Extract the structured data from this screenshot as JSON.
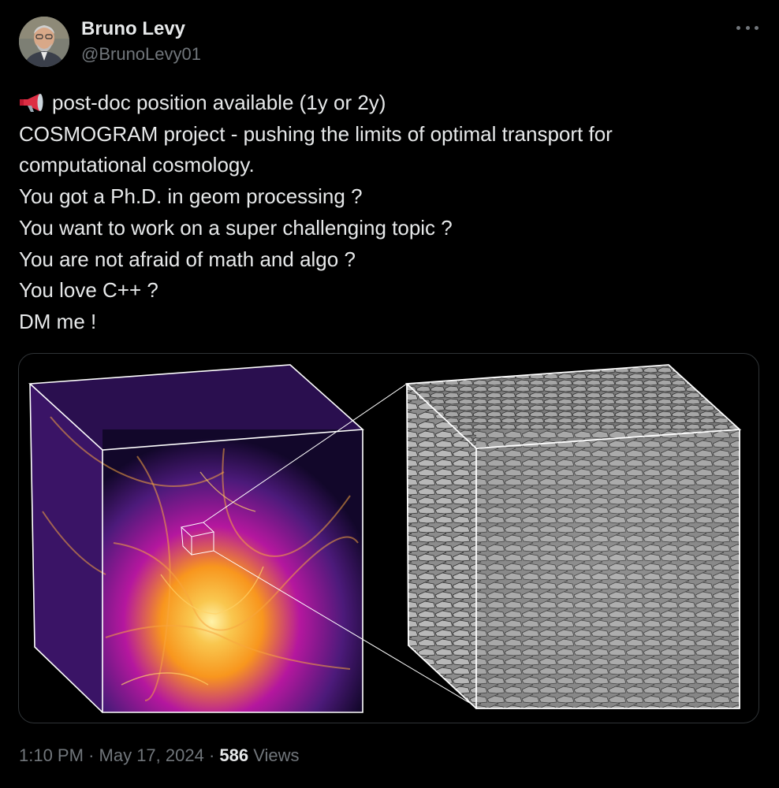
{
  "author": {
    "name": "Bruno Levy",
    "handle": "@BrunoLevy01"
  },
  "more_icon": "ellipsis-icon",
  "post": {
    "emoji_icon": "megaphone-icon",
    "lines": [
      "post-doc position available (1y or 2y)",
      "COSMOGRAM project - pushing the limits of optimal transport for",
      "computational cosmology.",
      "You got a Ph.D. in geom processing ?",
      "You want to work on a super challenging topic ?",
      "You are not afraid of math and algo ?",
      "You love C++ ?",
      "DM me !"
    ]
  },
  "media": {
    "left_panel": "cosmic-web-density-cube",
    "right_panel": "polyhedral-cells-cube"
  },
  "meta": {
    "time": "1:10 PM",
    "sep1": "·",
    "date": "May 17, 2024",
    "sep2": "·",
    "views_count": "586",
    "views_label": "Views"
  },
  "colors": {
    "background": "#000000",
    "text": "#e7e9ea",
    "secondary": "#71767b",
    "border": "#2f3336"
  }
}
